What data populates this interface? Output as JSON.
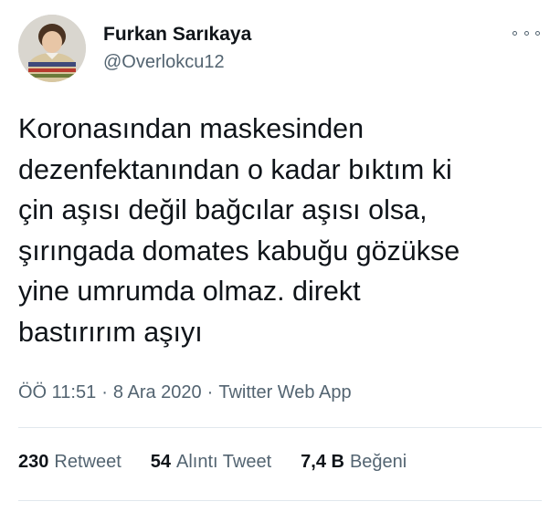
{
  "author": {
    "name": "Furkan Sarıkaya",
    "handle": "@Overlokcu12",
    "avatar_icon": "child-photo-avatar"
  },
  "more_icon": "more-options-icon",
  "tweet": {
    "lines": [
      "Koronasından maskesinden",
      "dezenfektanından o kadar bıktım ki",
      "çin aşısı değil bağcılar aşısı olsa,",
      "şırıngada domates kabuğu gözükse",
      "yine umrumda olmaz. direkt",
      "bastırırım aşıyı"
    ]
  },
  "meta": {
    "time": "ÖÖ 11:51",
    "separator": "·",
    "date": "8 Ara 2020",
    "source": "Twitter Web App"
  },
  "stats": {
    "retweets": {
      "count": "230",
      "label": "Retweet"
    },
    "quotes": {
      "count": "54",
      "label": "Alıntı Tweet"
    },
    "likes": {
      "count": "7,4 B",
      "label": "Beğeni"
    }
  },
  "colors": {
    "text_primary": "#0f1419",
    "text_secondary": "#536471",
    "divider": "#e1e8ed"
  }
}
